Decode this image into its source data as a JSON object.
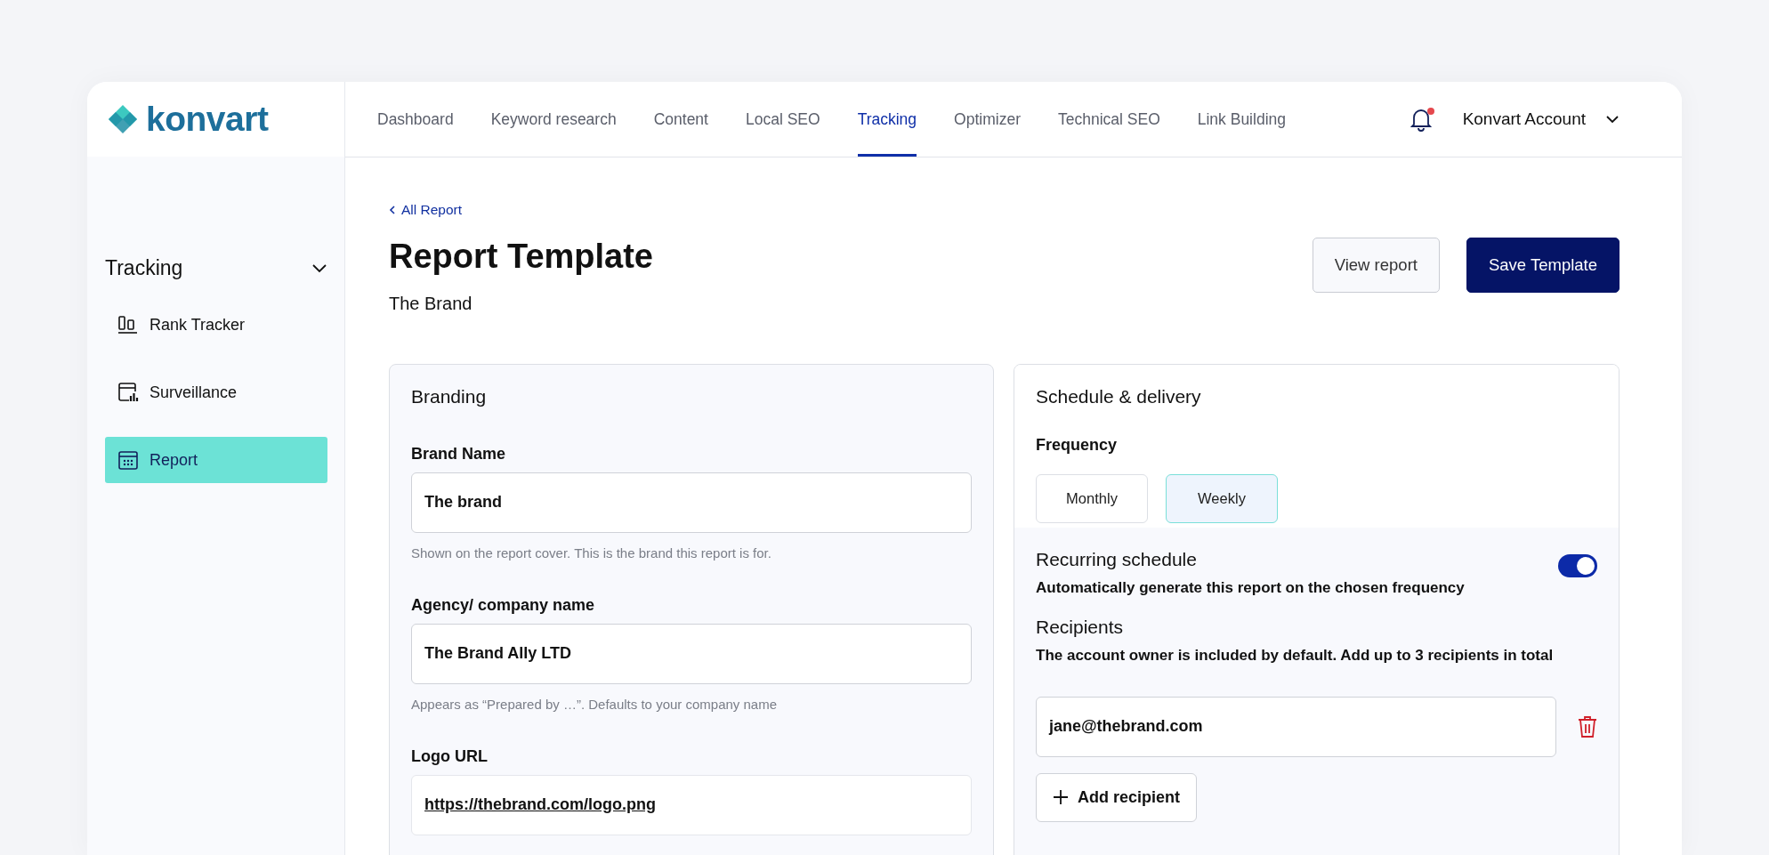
{
  "logo": {
    "text": "konvart"
  },
  "nav": {
    "tabs": [
      {
        "label": "Dashboard",
        "selected": false
      },
      {
        "label": "Keyword research",
        "selected": false
      },
      {
        "label": "Content",
        "selected": false
      },
      {
        "label": "Local SEO",
        "selected": false
      },
      {
        "label": "Tracking",
        "selected": true
      },
      {
        "label": "Optimizer",
        "selected": false
      },
      {
        "label": "Technical SEO",
        "selected": false
      },
      {
        "label": "Link Building",
        "selected": false
      }
    ],
    "notifications": {
      "unread": true
    },
    "account": "Konvart Account"
  },
  "sidebar": {
    "section": {
      "title": "Tracking",
      "expanded": true
    },
    "items": [
      {
        "label": "Rank Tracker",
        "selected": false
      },
      {
        "label": "Surveillance",
        "selected": false
      },
      {
        "label": "Report",
        "selected": true
      }
    ]
  },
  "breadcrumb": "All Report",
  "page": {
    "title": "Report Template",
    "subtitle": "The Brand",
    "actions": [
      {
        "label": "View report",
        "kind": "secondary"
      },
      {
        "label": "Save Template",
        "kind": "primary"
      }
    ]
  },
  "branding": {
    "title": "Branding",
    "fields": [
      {
        "label": "Brand Name",
        "value": "The brand",
        "hint": "Shown on the report cover. This is the brand this report is for.",
        "kind": "text"
      },
      {
        "label": "Agency/ company name",
        "value": "The Brand Ally LTD",
        "hint": "Appears as “Prepared by …”. Defaults to your company name",
        "kind": "text"
      },
      {
        "label": "Logo URL",
        "value": "https://thebrand.com/logo.png",
        "kind": "link"
      }
    ]
  },
  "schedule": {
    "title": "Schedule & delivery",
    "frequency_label": "Frequency",
    "frequency": [
      {
        "label": "Monthly",
        "selected": false
      },
      {
        "label": "Weekly",
        "selected": true
      }
    ],
    "recurring": {
      "title": "Recurring schedule",
      "description": "Automatically generate this report on the chosen frequency",
      "on": true
    },
    "recipients": {
      "title": "Recipients",
      "description": "The account owner is included by default. Add up to 3 recipients in total",
      "emails": [
        "jane@thebrand.com"
      ],
      "add_button": "Add recipient"
    }
  }
}
